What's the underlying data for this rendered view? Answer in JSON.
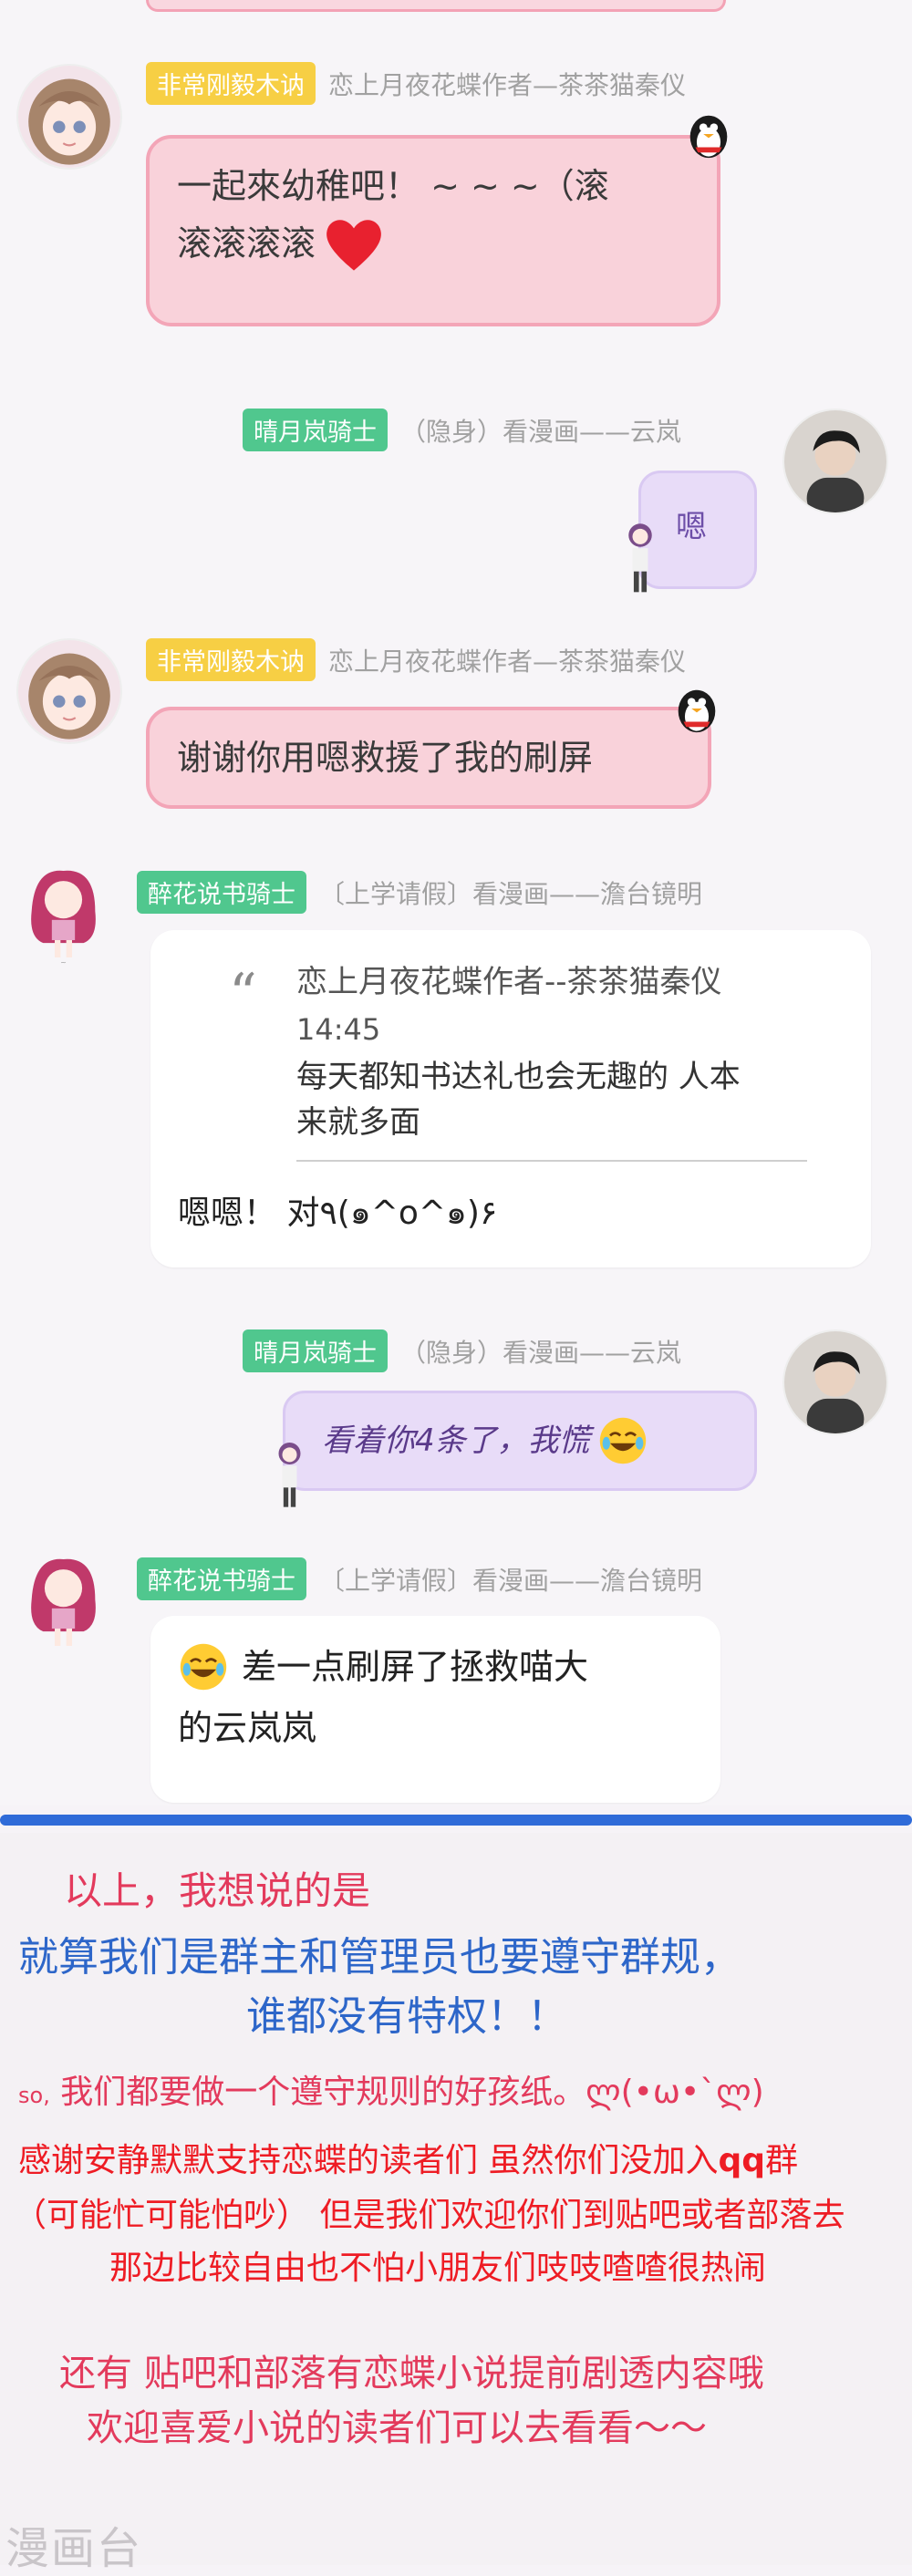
{
  "messages": {
    "m1": {
      "badge": "非常刚毅木讷",
      "sender": "恋上月夜花蝶作者—茶茶猫秦仪",
      "text_line1": "一起來幼稚吧！ ~ ~ ~（滚",
      "text_line2": "滚滚滚滚"
    },
    "m2": {
      "badge": "晴月岚骑士",
      "sender": "（隐身）看漫画——云岚",
      "sticker_text": "嗯"
    },
    "m3": {
      "badge": "非常刚毅木讷",
      "sender": "恋上月夜花蝶作者—茶茶猫秦仪",
      "text": "谢谢你用嗯救援了我的刷屏"
    },
    "m4": {
      "badge": "醉花说书骑士",
      "sender": "〔上学请假〕看漫画——澹台镜明",
      "quote_author": "恋上月夜花蝶作者--茶茶猫秦仪",
      "quote_time": "14:45",
      "quote_line1": "每天都知书达礼也会无趣的  人本",
      "quote_line2": "来就多面",
      "reply": "嗯嗯！ 对٩(๑^o^๑)۶"
    },
    "m5": {
      "badge": "晴月岚骑士",
      "sender": "（隐身）看漫画——云岚",
      "text": "看着你4条了，我慌"
    },
    "m6": {
      "badge": "醉花说书骑士",
      "sender": "〔上学请假〕看漫画——澹台镜明",
      "text_line1": "差一点刷屏了拯救喵大",
      "text_line2": "的云岚岚"
    }
  },
  "notes": {
    "line1": "以上，我想说的是",
    "line2": "就算我们是群主和管理员也要遵守群规，",
    "line3": "谁都没有特权！！",
    "line4_prefix": "so,",
    "line4": "我们都要做一个遵守规则的好孩纸。ლ(•ω•`ლ)",
    "line5a": "感谢安静默默支持恋蝶的读者们  虽然你们没加入",
    "line5b": "qq",
    "line5c": "群",
    "line6": "（可能忙可能怕吵） 但是我们欢迎你们到贴吧或者部落去",
    "line7": "那边比较自由也不怕小朋友们吱吱喳喳很热闹",
    "line8": "还有  贴吧和部落有恋蝶小说提前剧透内容哦",
    "line9": "欢迎喜爱小说的读者们可以去看看～～"
  },
  "watermark": "漫画台",
  "colors": {
    "accent_blue": "#2f6bd8",
    "note_red": "#e33a5c",
    "note_blue": "#2d66c9",
    "qq_red": "#ee1c24",
    "pink_bubble": "#f9d2da",
    "purple_bubble": "#e8dcf8"
  }
}
